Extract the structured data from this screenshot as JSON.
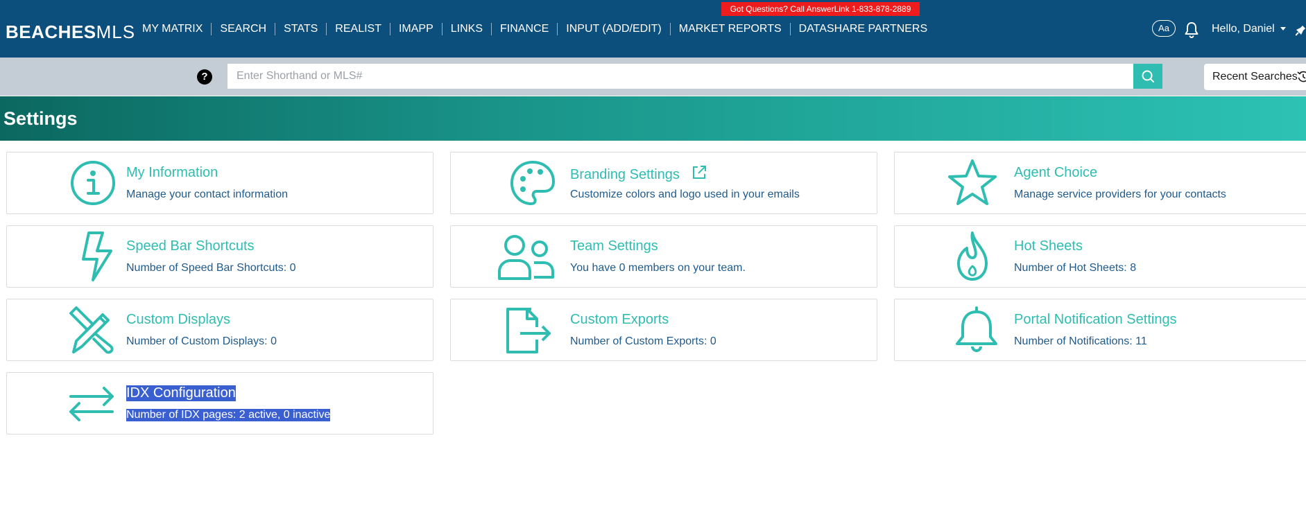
{
  "promo": {
    "text": "Got Questions? Call AnswerLink 1-833-878-2889"
  },
  "logo": {
    "bold": "BEACHES",
    "light": "MLS"
  },
  "nav": [
    "MY MATRIX",
    "SEARCH",
    "STATS",
    "REALIST",
    "IMAPP",
    "LINKS",
    "FINANCE",
    "INPUT (ADD/EDIT)",
    "MARKET REPORTS",
    "DATASHARE PARTNERS"
  ],
  "header_right": {
    "font_size_label": "Aa",
    "greeting": "Hello, Daniel"
  },
  "search": {
    "placeholder": "Enter Shorthand or MLS#",
    "help": "?",
    "recent_label": "Recent Searches"
  },
  "page": {
    "title": "Settings"
  },
  "cards": [
    {
      "title": "My Information",
      "desc": "Manage your contact information",
      "icon": "info-icon"
    },
    {
      "title": "Branding Settings",
      "desc": "Customize colors and logo used in your emails",
      "icon": "palette-icon"
    },
    {
      "title": "Agent Choice",
      "desc": "Manage service providers for your contacts",
      "icon": "star-icon"
    },
    {
      "title": "Speed Bar Shortcuts",
      "desc": "Number of Speed Bar Shortcuts: 0",
      "icon": "lightning-icon"
    },
    {
      "title": "Team Settings",
      "desc": "You have 0 members on your team.",
      "icon": "team-icon"
    },
    {
      "title": "Hot Sheets",
      "desc": "Number of Hot Sheets: 8",
      "icon": "flame-icon"
    },
    {
      "title": "Custom Displays",
      "desc": "Number of Custom Displays: 0",
      "icon": "pencil-ruler-icon"
    },
    {
      "title": "Custom Exports",
      "desc": "Number of Custom Exports: 0",
      "icon": "file-export-icon"
    },
    {
      "title": "Portal Notification Settings",
      "desc": "Number of Notifications: 11",
      "icon": "bell-icon"
    },
    {
      "title": "IDX Configuration",
      "desc": "Number of IDX pages: 2 active, 0 inactive",
      "icon": "arrows-exchange-icon"
    }
  ],
  "colors": {
    "topbar": "#0c4f7c",
    "accent_teal": "#2ebdb0",
    "desc_blue": "#1f5a8c",
    "promo_red": "#ee1c1c",
    "selection": "#3a5fd0"
  }
}
